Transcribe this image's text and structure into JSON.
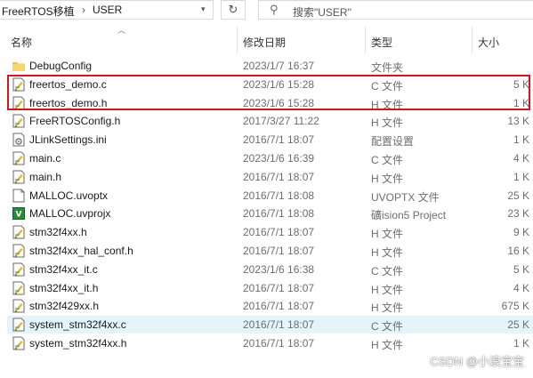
{
  "address_bar": {
    "crumbs": [
      "FreeRTOS移植",
      "USER"
    ],
    "separator": "›"
  },
  "search": {
    "placeholder": "搜索\"USER\""
  },
  "columns": {
    "name": "名称",
    "date": "修改日期",
    "type": "类型",
    "size": "大小"
  },
  "files": [
    {
      "name": "DebugConfig",
      "date": "2023/1/7 16:37",
      "type": "文件夹",
      "size": "",
      "icon": "folder-icon"
    },
    {
      "name": "freertos_demo.c",
      "date": "2023/1/6 15:28",
      "type": "C 文件",
      "size": "5 K",
      "icon": "source-file-icon"
    },
    {
      "name": "freertos_demo.h",
      "date": "2023/1/6 15:28",
      "type": "H 文件",
      "size": "1 K",
      "icon": "source-file-icon"
    },
    {
      "name": "FreeRTOSConfig.h",
      "date": "2017/3/27 11:22",
      "type": "H 文件",
      "size": "13 K",
      "icon": "source-file-icon"
    },
    {
      "name": "JLinkSettings.ini",
      "date": "2016/7/1 18:07",
      "type": "配置设置",
      "size": "1 K",
      "icon": "settings-file-icon"
    },
    {
      "name": "main.c",
      "date": "2023/1/6 16:39",
      "type": "C 文件",
      "size": "4 K",
      "icon": "source-file-icon"
    },
    {
      "name": "main.h",
      "date": "2016/7/1 18:07",
      "type": "H 文件",
      "size": "1 K",
      "icon": "source-file-icon"
    },
    {
      "name": "MALLOC.uvoptx",
      "date": "2016/7/1 18:08",
      "type": "UVOPTX 文件",
      "size": "25 K",
      "icon": "blank-file-icon"
    },
    {
      "name": "MALLOC.uvprojx",
      "date": "2016/7/1 18:08",
      "type": "礦ision5 Project",
      "size": "23 K",
      "icon": "keil-project-icon"
    },
    {
      "name": "stm32f4xx.h",
      "date": "2016/7/1 18:07",
      "type": "H 文件",
      "size": "9 K",
      "icon": "source-file-icon"
    },
    {
      "name": "stm32f4xx_hal_conf.h",
      "date": "2016/7/1 18:07",
      "type": "H 文件",
      "size": "16 K",
      "icon": "source-file-icon"
    },
    {
      "name": "stm32f4xx_it.c",
      "date": "2023/1/6 16:38",
      "type": "C 文件",
      "size": "5 K",
      "icon": "source-file-icon"
    },
    {
      "name": "stm32f4xx_it.h",
      "date": "2016/7/1 18:07",
      "type": "H 文件",
      "size": "4 K",
      "icon": "source-file-icon"
    },
    {
      "name": "stm32f429xx.h",
      "date": "2016/7/1 18:07",
      "type": "H 文件",
      "size": "675 K",
      "icon": "source-file-icon"
    },
    {
      "name": "system_stm32f4xx.c",
      "date": "2016/7/1 18:07",
      "type": "C 文件",
      "size": "25 K",
      "icon": "source-file-icon",
      "selected": true
    },
    {
      "name": "system_stm32f4xx.h",
      "date": "2016/7/1 18:07",
      "type": "H 文件",
      "size": "1 K",
      "icon": "source-file-icon"
    }
  ],
  "watermark": "CSDN @小浪宝宝",
  "colors": {
    "highlight_box": "#d9141b",
    "selection": "#e5f3fb",
    "folder": "#f3c64b"
  }
}
